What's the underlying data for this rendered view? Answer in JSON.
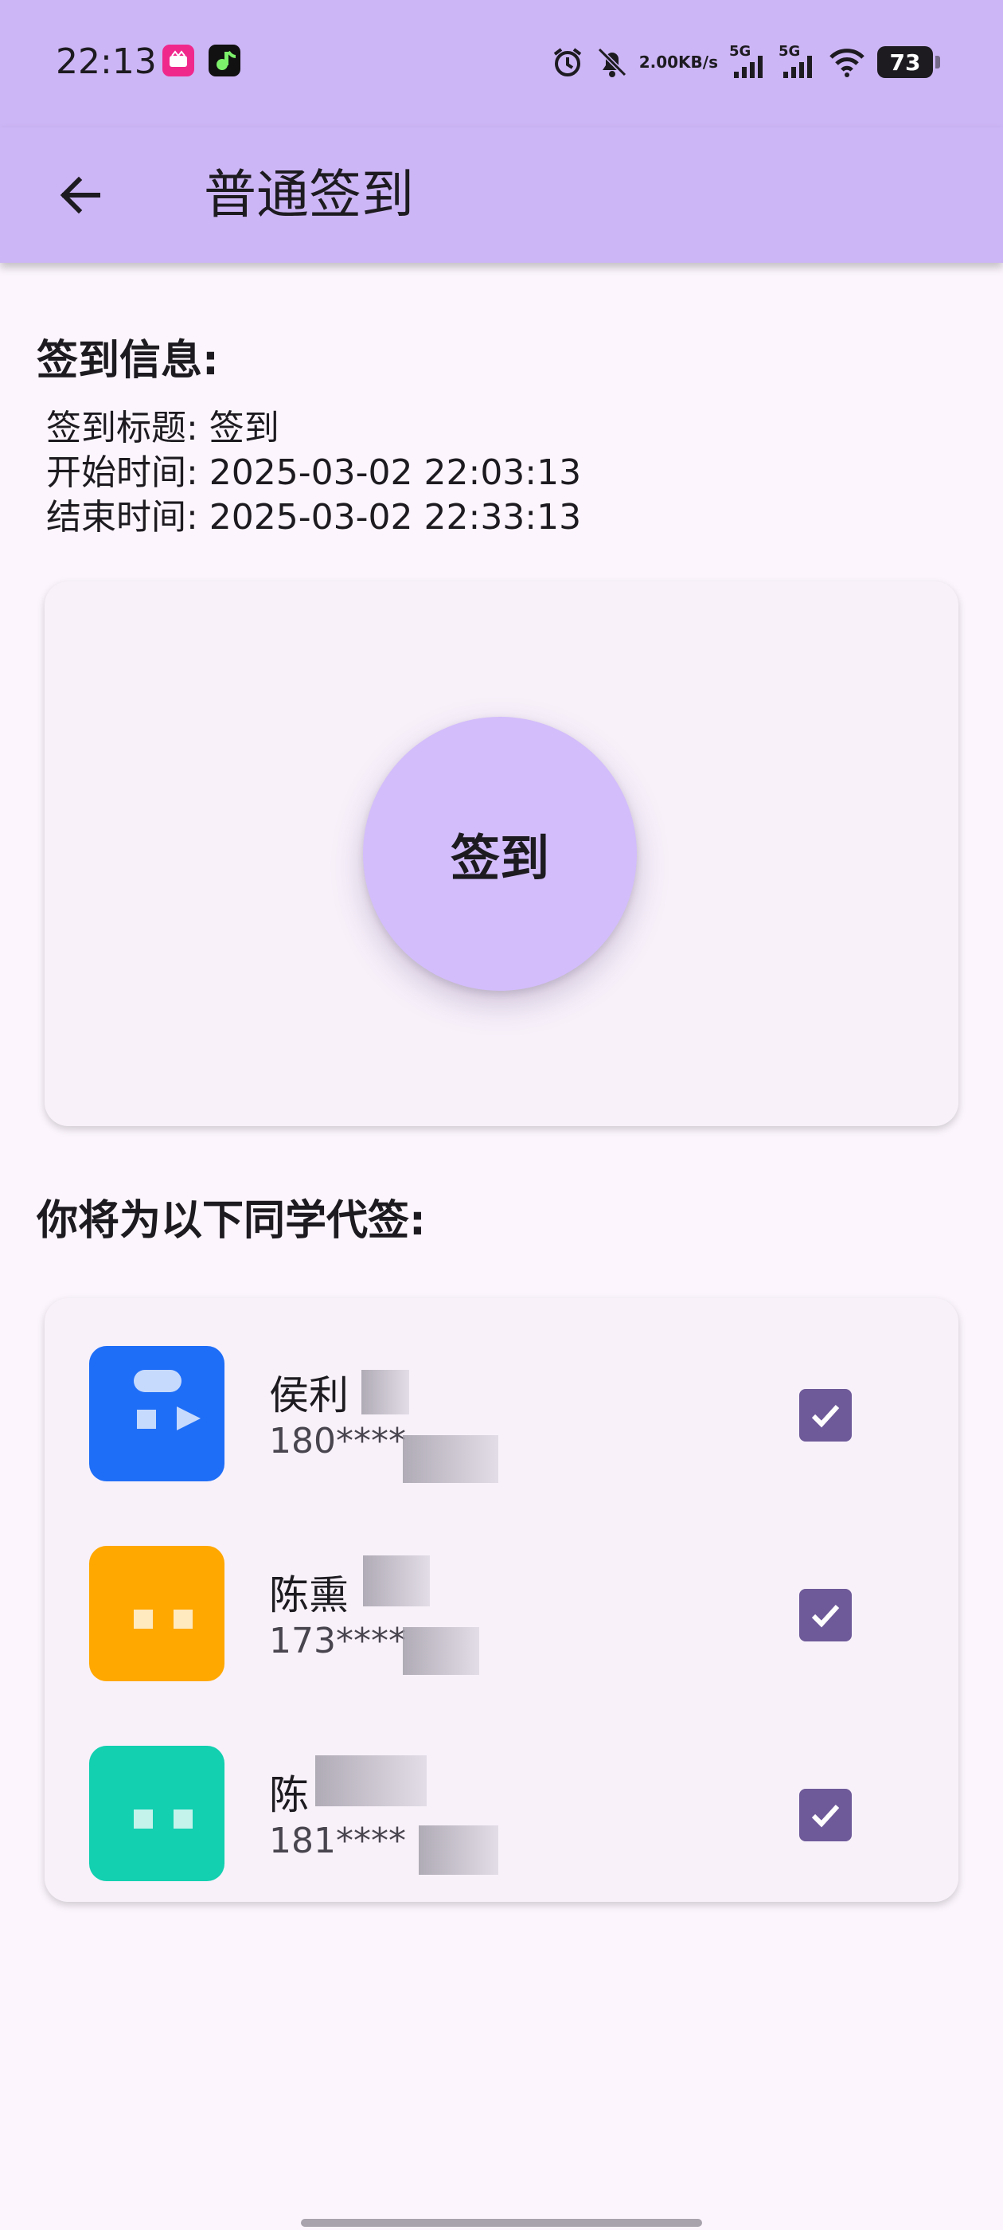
{
  "status_bar": {
    "time": "22:13",
    "network_speed_value": "2.00",
    "network_speed_unit": "KB/s",
    "signal_1": "5G",
    "signal_2": "5G",
    "battery_level": "73",
    "icons": [
      "app-music-icon",
      "app-tiktok-icon",
      "alarm-icon",
      "bell-off-icon",
      "signal-icon",
      "wifi-icon",
      "battery-icon"
    ]
  },
  "app_bar": {
    "title": "普通签到",
    "back_icon": "arrow-left-icon"
  },
  "checkin_info": {
    "heading": "签到信息:",
    "title_line": "签到标题: 签到",
    "start_line": "开始时间: 2025-03-02 22:03:13",
    "end_line": "结束时间: 2025-03-02 22:33:13"
  },
  "checkin_button": {
    "label": "签到"
  },
  "proxy_section": {
    "heading": "你将为以下同学代签:",
    "students": [
      {
        "name": "侯利",
        "phone": "180****",
        "checked": true,
        "avatar_color": "#1f6ef7"
      },
      {
        "name": "陈熏",
        "phone": "173****",
        "checked": true,
        "avatar_color": "#ffa800"
      },
      {
        "name": "陈",
        "phone": "181****",
        "checked": true,
        "avatar_color": "#12d0b0"
      }
    ]
  },
  "colors": {
    "header_bg": "#cdb6f5",
    "page_bg": "#fcf5fd",
    "card_bg": "#f8f1fa",
    "button_bg": "#d3bdfb",
    "checkbox_bg": "#6e5a99"
  }
}
